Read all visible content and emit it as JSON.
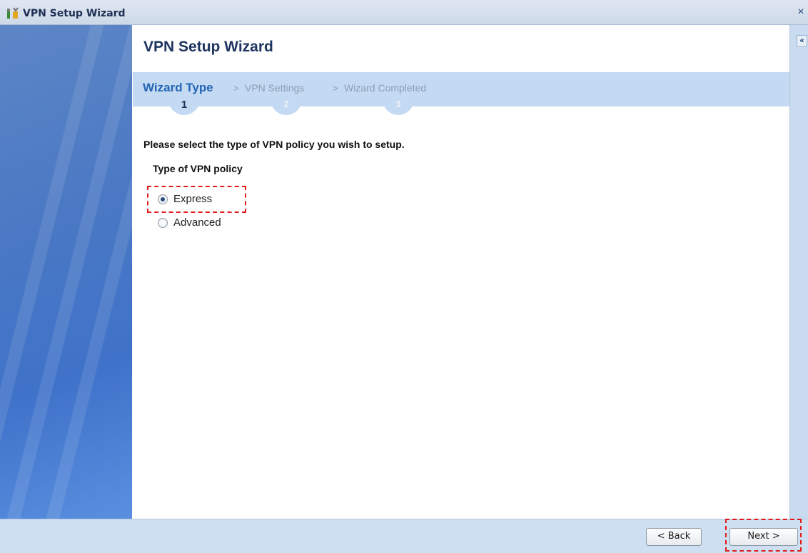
{
  "window": {
    "title": "VPN Setup Wizard",
    "close_glyph": "×",
    "title_icon": "wizard-tools-icon"
  },
  "collapse_glyph": "«",
  "main": {
    "heading": "VPN Setup Wizard",
    "steps": [
      {
        "label": "Wizard Type",
        "number": "1",
        "active": true
      },
      {
        "label": "VPN Settings",
        "number": "2",
        "active": false
      },
      {
        "label": "Wizard Completed",
        "number": "3",
        "active": false
      }
    ],
    "step_separator": ">",
    "prompt": "Please select the type of VPN policy you wish to setup.",
    "policy_label": "Type of VPN policy",
    "options": [
      {
        "label": "Express",
        "checked": true
      },
      {
        "label": "Advanced",
        "checked": false
      }
    ]
  },
  "footer": {
    "back_label": "< Back",
    "next_label": "Next >"
  },
  "colors": {
    "accent": "#2465b5",
    "heading": "#1e3560",
    "highlight": "#e01b1b",
    "step_bar": "#c4daf3"
  }
}
